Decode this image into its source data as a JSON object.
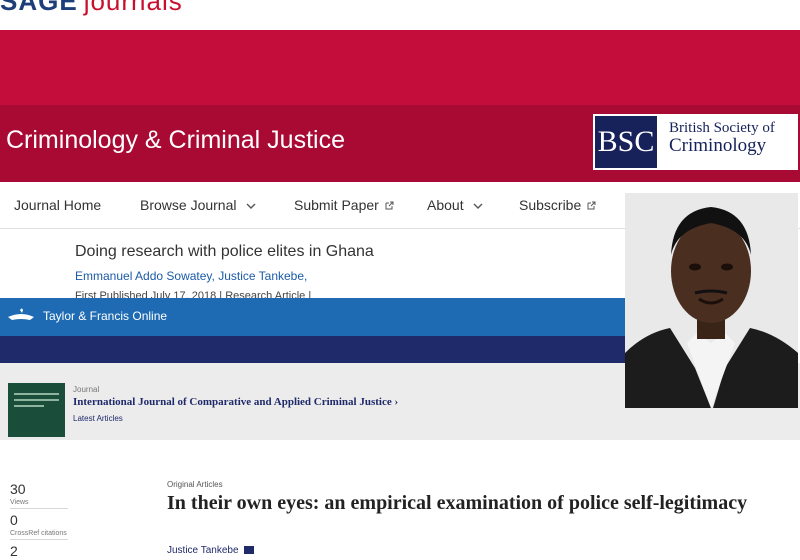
{
  "sage": {
    "logo_brand": "SAGE",
    "logo_suffix": "journals",
    "journal_title": "Criminology & Criminal Justice",
    "partner_logo": {
      "abbr": "BSC",
      "line1": "British Society of",
      "line2": "Criminology"
    },
    "nav": [
      {
        "label": "Journal Home",
        "icon": ""
      },
      {
        "label": "Browse Journal",
        "icon": "chevron-down-icon"
      },
      {
        "label": "Submit Paper",
        "icon": "external-link-icon"
      },
      {
        "label": "About",
        "icon": "chevron-down-icon"
      },
      {
        "label": "Subscribe",
        "icon": "external-link-icon"
      }
    ],
    "article": {
      "title": "Doing research with police elites in Ghana",
      "authors": "Emmanuel Addo Sowatey, Justice Tankebe,",
      "published": "First Published July 17, 2018 | Research Article |"
    }
  },
  "tf": {
    "brand": "Taylor & Francis Online",
    "journal_kicker": "Journal",
    "journal_name": "International Journal of Comparative and Applied Criminal Justice",
    "latest_articles": "Latest Articles",
    "stats": [
      {
        "value": "30",
        "label": "Views"
      },
      {
        "value": "0",
        "label": "CrossRef citations"
      },
      {
        "value": "2",
        "label": ""
      }
    ],
    "article": {
      "section": "Original Articles",
      "title": "In their own eyes: an empirical examination of police self-legitimacy",
      "author": "Justice Tankebe"
    }
  },
  "colors": {
    "sage_red": "#c40d3a",
    "sage_red_dark": "#a80a33",
    "tf_blue": "#1e6bb3",
    "tf_navy": "#1f2a6b",
    "link_blue": "#1b5aa6"
  }
}
